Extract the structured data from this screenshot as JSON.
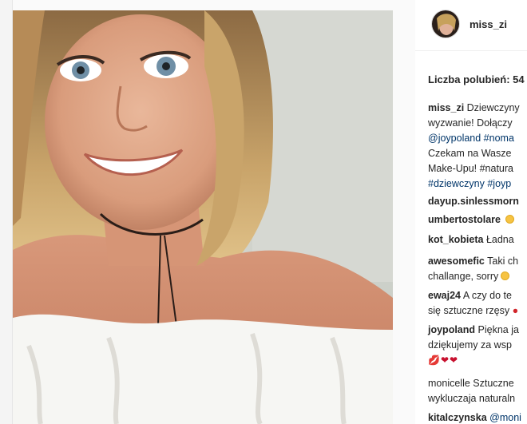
{
  "post": {
    "username": "miss_zi",
    "likes_text": "Liczba polubień: 54"
  },
  "comments": [
    {
      "user": "miss_zi",
      "lines": [
        "Dziewczyny",
        "wyzwanie! Dołączy",
        "@joypoland #noma",
        "Czekam na Wasze",
        "Make-Upu! #natura",
        "#dziewczyny #joyp"
      ]
    },
    {
      "user": "dayup.sinlessmorn",
      "text": ""
    },
    {
      "user": "umbertostolare",
      "text": ""
    },
    {
      "user": "kot_kobieta",
      "text": "Ładna"
    },
    {
      "user": "awesomefic",
      "text": "Taki ch",
      "line2": "challange, sorry"
    },
    {
      "user": "ewaj24",
      "text": "A czy do te",
      "line2": "się sztuczne rzęsy"
    },
    {
      "user": "joypoland",
      "text": "Piękna ja",
      "line2": "dziękujemy za wsp"
    },
    {
      "user": "monicelle",
      "text": "Sztuczne",
      "line2": "wykluczaja naturaln"
    },
    {
      "user": "kitalczynska",
      "text": "@moni"
    }
  ]
}
